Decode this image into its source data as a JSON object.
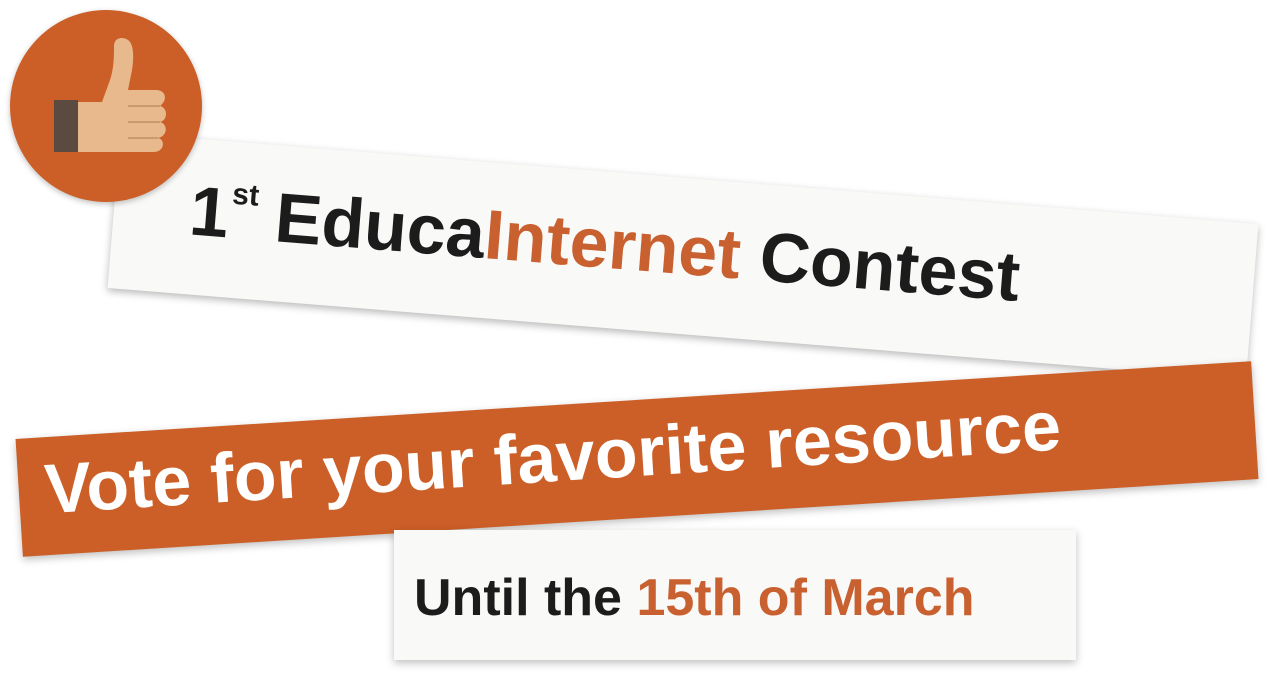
{
  "title": {
    "number": "1",
    "ordinal_suffix": "st",
    "brand_part1": "Educa",
    "brand_part2": "Internet",
    "word": "Contest"
  },
  "vote": {
    "text": "Vote for your favorite resource"
  },
  "deadline": {
    "prefix": "Until the",
    "date": "15th of March"
  },
  "icons": {
    "thumb": "thumbs-up-icon"
  },
  "colors": {
    "accent": "#cc5f27",
    "text_dark": "#1c1c1c",
    "banner_light": "#f9f9f7"
  }
}
